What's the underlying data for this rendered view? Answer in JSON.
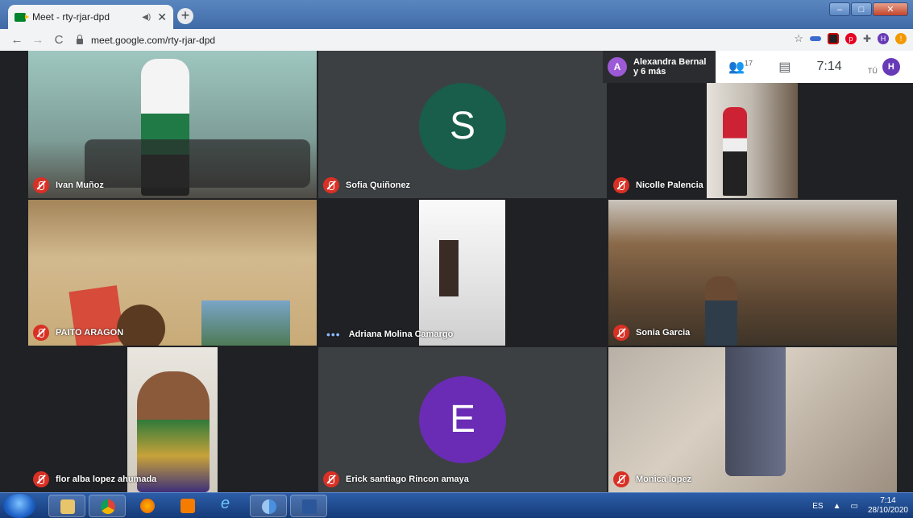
{
  "browser": {
    "tab_title": "Meet - rty-rjar-dpd",
    "url": "meet.google.com/rty-rjar-dpd"
  },
  "meet": {
    "presenting_initial": "A",
    "presenting_name": "Alexandra Bernal",
    "presenting_more": "y 6 más",
    "participants_count": "17",
    "time": "7:14",
    "you_label": "TÚ",
    "self_initial": "H"
  },
  "tiles": [
    {
      "name": "Ivan Muñoz"
    },
    {
      "name": "Sofia Quiñonez",
      "initial": "S",
      "color": "#185e4a"
    },
    {
      "name": "Nicolle Palencia"
    },
    {
      "name": "PAITO ARAGON"
    },
    {
      "name": "Adriana Molina Camargo"
    },
    {
      "name": "Sonia Garcia"
    },
    {
      "name": "flor alba lopez ahumada"
    },
    {
      "name": "Erick santiago Rincon amaya",
      "initial": "E",
      "color": "#6a2bb5"
    },
    {
      "name": "Monica lopez"
    }
  ],
  "taskbar": {
    "lang": "ES",
    "time": "7:14",
    "date": "28/10/2020"
  }
}
